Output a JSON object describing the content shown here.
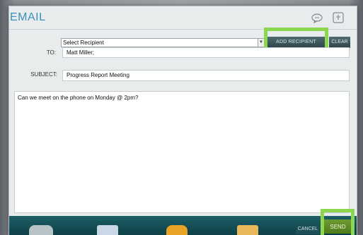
{
  "window": {
    "title": "EMAIL"
  },
  "icons": {
    "chat": "chat-bubble-icon",
    "help": "help-icon"
  },
  "recipient": {
    "select_value": "Select Recipient",
    "add_label": "ADD RECIPIENT",
    "clear_label": "CLEAR"
  },
  "to": {
    "label": "TO:",
    "value": "Matt Miller;"
  },
  "subject": {
    "label": "SUBJECT:",
    "value": "Progress Report Meeting"
  },
  "message": {
    "body": "Can we meet on the phone on Monday @ 2pm?"
  },
  "actions": {
    "cancel_label": "CANCEL",
    "send_label": "SEND"
  },
  "colors": {
    "title": "#3c8fb8",
    "highlight": "#8dd64f",
    "toolbar": "#0e3f46",
    "send": "#5a8624"
  }
}
